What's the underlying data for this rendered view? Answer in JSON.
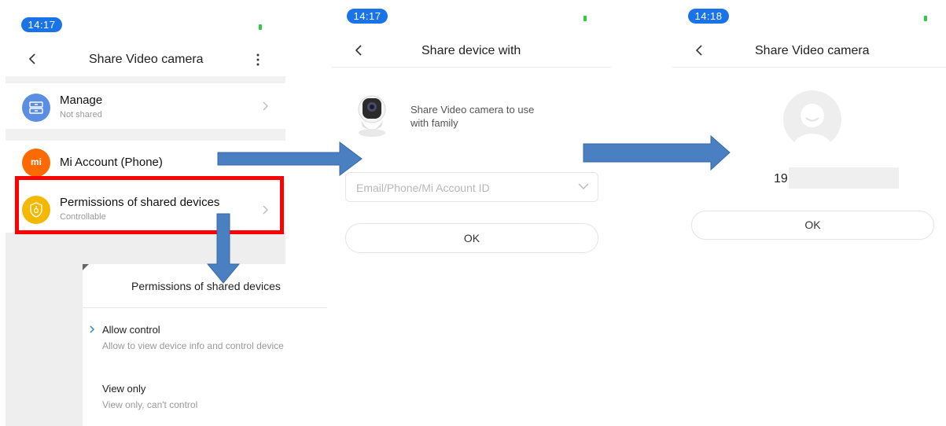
{
  "screen1": {
    "time": "14:17",
    "title": "Share Video camera",
    "more_icon": "more-vertical-icon",
    "manage": {
      "label": "Manage",
      "sub": "Not shared"
    },
    "mi_account": {
      "label": "Mi Account (Phone)",
      "logo_text": "mi"
    },
    "permissions": {
      "label": "Permissions of shared devices",
      "sub": "Controllable"
    }
  },
  "popup": {
    "title": "Permissions of shared devices",
    "options": [
      {
        "label": "Allow control",
        "desc": "Allow to view device info and control device",
        "selected": true
      },
      {
        "label": "View only",
        "desc": "View only, can't control",
        "selected": false
      }
    ]
  },
  "screen2": {
    "time": "14:17",
    "title": "Share device with",
    "device_text_line1": "Share Video camera to use",
    "device_text_line2": "with family",
    "input_placeholder": "Email/Phone/Mi Account ID",
    "ok_label": "OK"
  },
  "screen3": {
    "time": "14:18",
    "title": "Share Video camera",
    "account_value": "19",
    "ok_label": "OK"
  },
  "colors": {
    "highlight": "#ff0000",
    "arrow": "#4a7fc1",
    "time_pill": "#1a73e8",
    "manage_icon": "#5b8de3",
    "mi_icon": "#ff6a00",
    "permissions_icon": "#f5b800"
  }
}
